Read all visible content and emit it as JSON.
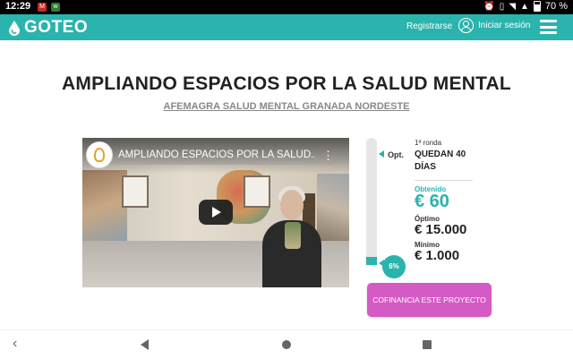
{
  "statusbar": {
    "time": "12:29",
    "battery": "70 %",
    "icons": [
      "gmail-icon",
      "whatsapp-icon",
      "alarm-icon",
      "vibrate-icon",
      "wifi-icon",
      "signal-icon",
      "battery-icon"
    ]
  },
  "header": {
    "logo": "GOTEO",
    "register": "Registrarse",
    "login": "Iniciar sesión",
    "brand_color": "#2bb3ad"
  },
  "project": {
    "title": "AMPLIANDO ESPACIOS POR LA SALUD MENTAL",
    "organization": "AFEMAGRA SALUD MENTAL GRANADA NORDESTE"
  },
  "video": {
    "title": "AMPLIANDO ESPACIOS POR LA SALUD..."
  },
  "funding": {
    "optimum_marker_label": "Opt.",
    "progress_percent_label": "6%",
    "progress_fraction": 0.06,
    "round": "1ª ronda",
    "days_left": "QUEDAN 40 DÍAS",
    "obtained_label": "Obtenido",
    "obtained": "€ 60",
    "optimum_label": "Óptimo",
    "optimum": "€ 15.000",
    "minimum_label": "Mínimo",
    "minimum": "€ 1.000",
    "cta": "COFINANCIA ESTE PROYECTO",
    "cta_color": "#d45bc4"
  }
}
